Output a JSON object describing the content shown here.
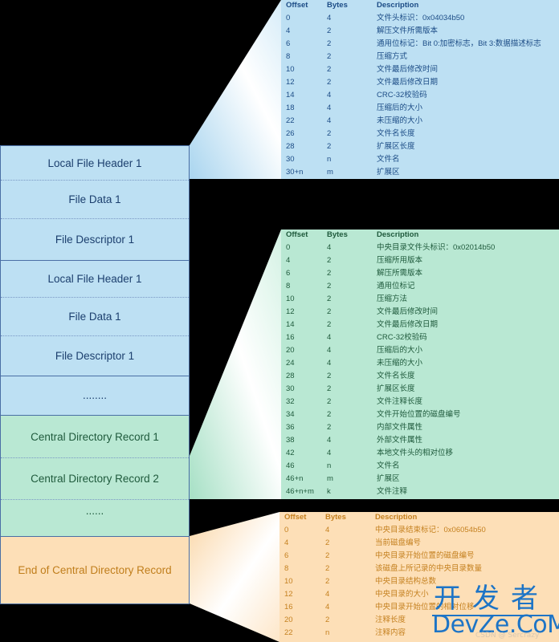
{
  "colors": {
    "background": "#000000",
    "blue_fill": "#bde0f3",
    "green_fill": "#b9e8d3",
    "orange_fill": "#fddfb7",
    "border": "#4a6fa5",
    "blue_text": "#1c3f6e",
    "green_text": "#1f5a3c",
    "orange_text": "#c07e1c",
    "watermark": "#1d74c6"
  },
  "stack": {
    "local_section": [
      "Local File Header 1",
      "File Data 1",
      "File Descriptor 1",
      "Local File Header 1",
      "File Data 1",
      "File Descriptor 1",
      "........"
    ],
    "central_section": [
      "Central Directory Record 1",
      "Central Directory Record 2",
      "......"
    ],
    "end_section": [
      "End of Central Directory Record"
    ]
  },
  "tables": {
    "local_file_header": {
      "headers": [
        "Offset",
        "Bytes",
        "Description"
      ],
      "rows": [
        [
          "0",
          "4",
          "文件头标识：0x04034b50"
        ],
        [
          "4",
          "2",
          "解压文件所需版本"
        ],
        [
          "6",
          "2",
          "通用位标记：Bit 0:加密标志，Bit 3:数据描述标志"
        ],
        [
          "8",
          "2",
          "压缩方式"
        ],
        [
          "10",
          "2",
          "文件最后修改时间"
        ],
        [
          "12",
          "2",
          "文件最后修改日期"
        ],
        [
          "14",
          "4",
          "CRC-32校验码"
        ],
        [
          "18",
          "4",
          "压缩后的大小"
        ],
        [
          "22",
          "4",
          "未压缩的大小"
        ],
        [
          "26",
          "2",
          "文件名长度"
        ],
        [
          "28",
          "2",
          "扩展区长度"
        ],
        [
          "30",
          "n",
          "文件名"
        ],
        [
          "30+n",
          "m",
          "扩展区"
        ]
      ]
    },
    "central_directory": {
      "headers": [
        "Offset",
        "Bytes",
        "Description"
      ],
      "rows": [
        [
          "0",
          "4",
          "中央目录文件头标识：0x02014b50"
        ],
        [
          "4",
          "2",
          "压缩所用版本"
        ],
        [
          "6",
          "2",
          "解压所需版本"
        ],
        [
          "8",
          "2",
          "通用位标记"
        ],
        [
          "10",
          "2",
          "压缩方法"
        ],
        [
          "12",
          "2",
          "文件最后修改时间"
        ],
        [
          "14",
          "2",
          "文件最后修改日期"
        ],
        [
          "16",
          "4",
          "CRC-32校验码"
        ],
        [
          "20",
          "4",
          "压缩后的大小"
        ],
        [
          "24",
          "4",
          "未压缩的大小"
        ],
        [
          "28",
          "2",
          "文件名长度"
        ],
        [
          "30",
          "2",
          "扩展区长度"
        ],
        [
          "32",
          "2",
          "文件注释长度"
        ],
        [
          "34",
          "2",
          "文件开始位置的磁盘编号"
        ],
        [
          "36",
          "2",
          "内部文件属性"
        ],
        [
          "38",
          "4",
          "外部文件属性"
        ],
        [
          "42",
          "4",
          "本地文件头的相对位移"
        ],
        [
          "46",
          "n",
          "文件名"
        ],
        [
          "46+n",
          "m",
          "扩展区"
        ],
        [
          "46+n+m",
          "k",
          "文件注释"
        ]
      ]
    },
    "end_of_central_directory": {
      "headers": [
        "Offset",
        "Bytes",
        "Description"
      ],
      "rows": [
        [
          "0",
          "4",
          "中央目录结束标记：0x06054b50"
        ],
        [
          "4",
          "2",
          "当前磁盘编号"
        ],
        [
          "6",
          "2",
          "中央目录开始位置的磁盘编号"
        ],
        [
          "8",
          "2",
          "该磁盘上所记录的中央目录数量"
        ],
        [
          "10",
          "2",
          "中央目录结构总数"
        ],
        [
          "12",
          "4",
          "中央目录的大小"
        ],
        [
          "16",
          "4",
          "中央目录开始位置的相对位移"
        ],
        [
          "20",
          "2",
          "注释长度"
        ],
        [
          "22",
          "n",
          "注释内容"
        ]
      ]
    }
  },
  "watermark": {
    "chinese": "开发者",
    "domain": "DevZe.CoM",
    "sub": "CSDN @ Sercrazy"
  }
}
